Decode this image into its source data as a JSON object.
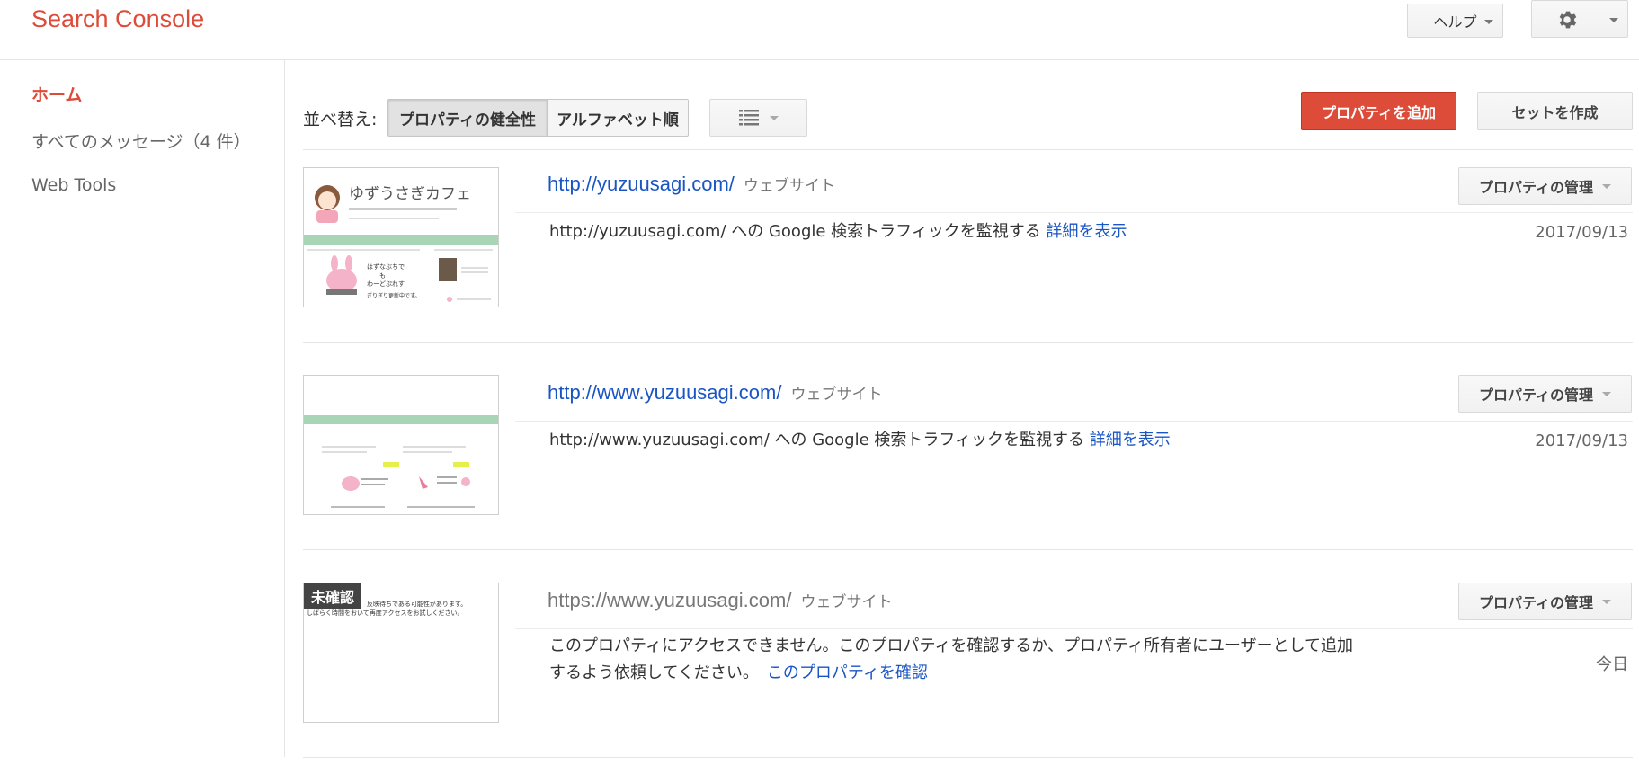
{
  "app": {
    "title": "Search Console"
  },
  "header": {
    "help_label": "ヘルプ"
  },
  "sidebar": {
    "items": [
      {
        "label": "ホーム",
        "active": true
      },
      {
        "label": "すべてのメッセージ（4 件）"
      },
      {
        "label": "Web Tools"
      }
    ]
  },
  "toolbar": {
    "sort_label": "並べ替え:",
    "sort_options": [
      "プロパティの健全性",
      "アルファベット順"
    ],
    "sort_selected": "プロパティの健全性",
    "add_property_label": "プロパティを追加",
    "create_set_label": "セットを作成"
  },
  "properties": [
    {
      "url": "http://yuzuusagi.com/",
      "type": "ウェブサイト",
      "manage_label": "プロパティの管理",
      "description": "http://yuzuusagi.com/ への Google 検索トラフィックを監視する",
      "link": "詳細を表示",
      "date": "2017/09/13",
      "thumb_title": "ゆずうさぎカフェ",
      "thumb_lines": [
        "はずなぶちで",
        "も",
        "わーどぷれす",
        "ぎりぎり更新中です。"
      ]
    },
    {
      "url": "http://www.yuzuusagi.com/",
      "type": "ウェブサイト",
      "manage_label": "プロパティの管理",
      "description": "http://www.yuzuusagi.com/ への Google 検索トラフィックを監視する",
      "link": "詳細を表示",
      "date": "2017/09/13"
    },
    {
      "url": "https://www.yuzuusagi.com/",
      "type": "ウェブサイト",
      "manage_label": "プロパティの管理",
      "description_line1": "このプロパティにアクセスできません。このプロパティを確認するか、プロパティ所有者にユーザーとして追加",
      "description_line2": "するよう依頼してください。",
      "link": "このプロパティを確認",
      "date": "今日",
      "badge": "未確認",
      "thumb_text_1": "反映待ちである可能性があります。",
      "thumb_text_2": "しばらく時間をおいて再度アクセスをお試しください。"
    }
  ],
  "colors": {
    "brand": "#dd4b39",
    "link": "#1a55c4",
    "thumb_accent": "#a8d5b5"
  }
}
